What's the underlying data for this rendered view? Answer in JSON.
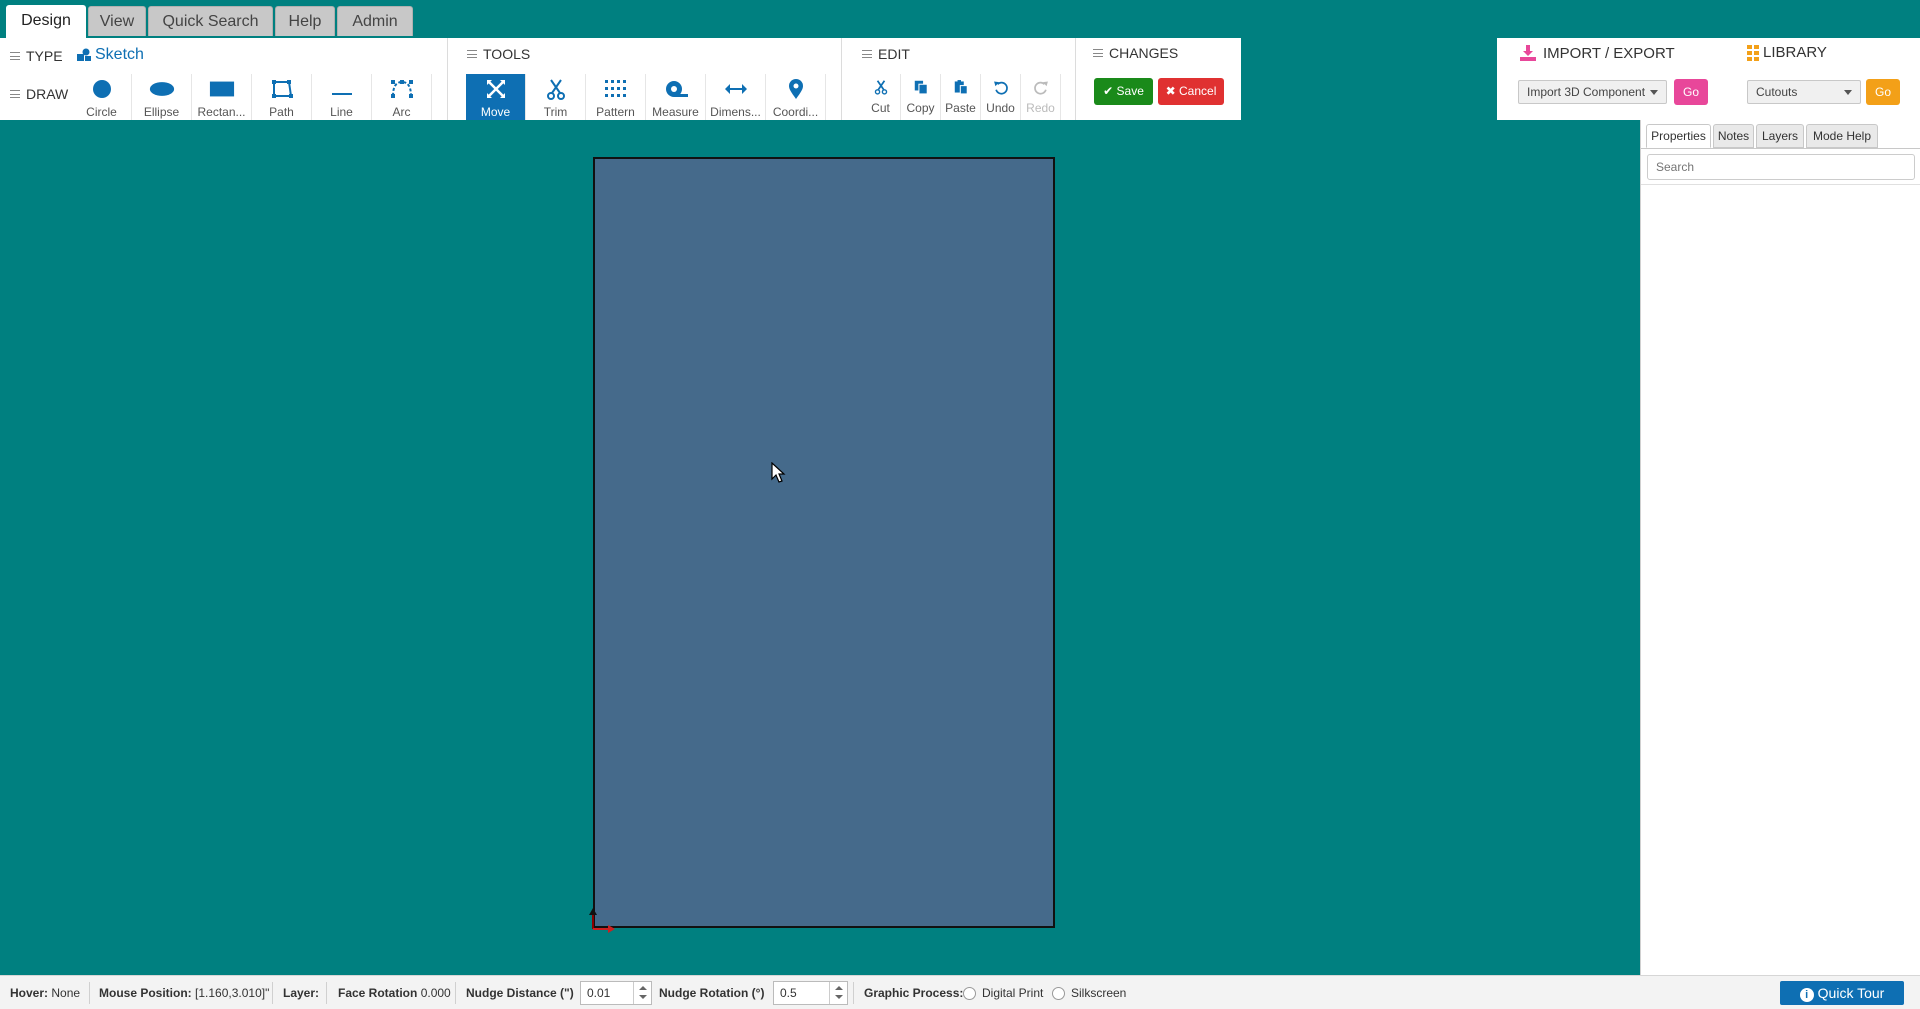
{
  "menu_tabs": [
    "Design",
    "View",
    "Quick Search",
    "Help",
    "Admin"
  ],
  "type_group": {
    "title": "TYPE",
    "sketch_label": "Sketch"
  },
  "draw_group": {
    "title": "DRAW",
    "tools": [
      {
        "label": "Circle",
        "icon": "circle-icon"
      },
      {
        "label": "Ellipse",
        "icon": "ellipse-icon"
      },
      {
        "label": "Rectan...",
        "icon": "rectangle-icon"
      },
      {
        "label": "Path",
        "icon": "path-icon"
      },
      {
        "label": "Line",
        "icon": "line-icon"
      },
      {
        "label": "Arc",
        "icon": "arc-icon"
      }
    ]
  },
  "tools_group": {
    "title": "TOOLS",
    "tools": [
      {
        "label": "Move",
        "icon": "move-icon",
        "active": true
      },
      {
        "label": "Trim",
        "icon": "scissors-icon"
      },
      {
        "label": "Pattern",
        "icon": "pattern-icon"
      },
      {
        "label": "Measure",
        "icon": "tape-measure-icon"
      },
      {
        "label": "Dimens...",
        "icon": "dimension-arrows-icon"
      },
      {
        "label": "Coordi...",
        "icon": "map-pin-icon"
      }
    ]
  },
  "edit_group": {
    "title": "EDIT",
    "tools": [
      {
        "label": "Cut",
        "icon": "scissors-icon"
      },
      {
        "label": "Copy",
        "icon": "copy-icon"
      },
      {
        "label": "Paste",
        "icon": "paste-icon"
      },
      {
        "label": "Undo",
        "icon": "undo-icon"
      },
      {
        "label": "Redo",
        "icon": "redo-icon",
        "disabled": true
      }
    ]
  },
  "changes_group": {
    "title": "CHANGES",
    "save_label": "Save",
    "cancel_label": "Cancel"
  },
  "import_export": {
    "title": "IMPORT / EXPORT",
    "select_value": "Import 3D Component",
    "go_label": "Go"
  },
  "library": {
    "title": "LIBRARY",
    "select_value": "Cutouts",
    "go_label": "Go"
  },
  "right_panel": {
    "tabs": [
      "Properties",
      "Notes",
      "Layers",
      "Mode Help"
    ],
    "search_placeholder": "Search"
  },
  "status_bar": {
    "hover_label": "Hover:",
    "hover_value": "None",
    "mouse_label": "Mouse Position:",
    "mouse_value": "[1.160,3.010]\"",
    "layer_label": "Layer:",
    "face_rotation_label": "Face Rotation",
    "face_rotation_value": "0.000",
    "nudge_distance_label": "Nudge Distance (\")",
    "nudge_distance_value": "0.01",
    "nudge_rotation_label": "Nudge Rotation (°)",
    "nudge_rotation_value": "0.5",
    "graphic_process_label": "Graphic Process:",
    "digital_print_label": "Digital Print",
    "silkscreen_label": "Silkscreen",
    "quick_tour_label": "Quick Tour"
  },
  "colors": {
    "background": "#008080",
    "board": "#456a8b",
    "active_tool": "#0e6fb3",
    "save": "#1a8a1a",
    "cancel": "#e03131",
    "import_go": "#e8479a",
    "library_go": "#f3a018"
  }
}
